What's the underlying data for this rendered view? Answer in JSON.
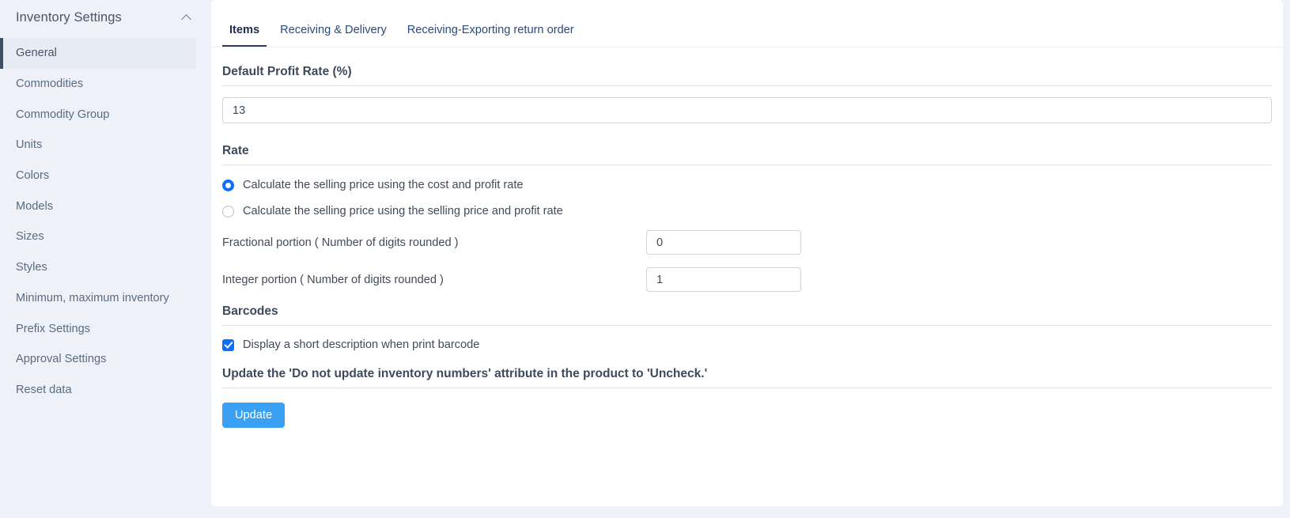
{
  "sidebar": {
    "title": "Inventory Settings",
    "collapse_icon": "chevron-up-icon",
    "items": [
      {
        "label": "General",
        "active": true
      },
      {
        "label": "Commodities",
        "active": false
      },
      {
        "label": "Commodity Group",
        "active": false
      },
      {
        "label": "Units",
        "active": false
      },
      {
        "label": "Colors",
        "active": false
      },
      {
        "label": "Models",
        "active": false
      },
      {
        "label": "Sizes",
        "active": false
      },
      {
        "label": "Styles",
        "active": false
      },
      {
        "label": "Minimum, maximum inventory",
        "active": false
      },
      {
        "label": "Prefix Settings",
        "active": false
      },
      {
        "label": "Approval Settings",
        "active": false
      },
      {
        "label": "Reset data",
        "active": false
      }
    ]
  },
  "tabs": [
    {
      "label": "Items",
      "active": true
    },
    {
      "label": "Receiving & Delivery",
      "active": false
    },
    {
      "label": "Receiving-Exporting return order",
      "active": false
    }
  ],
  "main": {
    "profit_rate": {
      "heading": "Default Profit Rate (%)",
      "value": "13",
      "placeholder": ""
    },
    "rate": {
      "heading": "Rate",
      "options": [
        {
          "label": "Calculate the selling price using the cost and profit rate",
          "selected": true
        },
        {
          "label": "Calculate the selling price using the selling price and profit rate",
          "selected": false
        }
      ],
      "fields": [
        {
          "label": "Fractional portion ( Number of digits rounded )",
          "value": "0"
        },
        {
          "label": "Integer portion ( Number of digits rounded )",
          "value": "1"
        }
      ]
    },
    "barcodes": {
      "heading": "Barcodes",
      "checkbox_label": "Display a short description when print barcode",
      "checked": true
    },
    "update_section": {
      "heading": "Update the 'Do not update inventory numbers' attribute in the product to 'Uncheck.'",
      "button_label": "Update"
    }
  },
  "colors": {
    "page_background": "#eef1f8",
    "card_background": "#ffffff",
    "accent_blue": "#0d6efd",
    "button_blue": "#3aa0f3",
    "active_nav_bar": "#3f4e63",
    "tab_active_underline": "#2c3e5d",
    "divider": "#dee2e6"
  }
}
